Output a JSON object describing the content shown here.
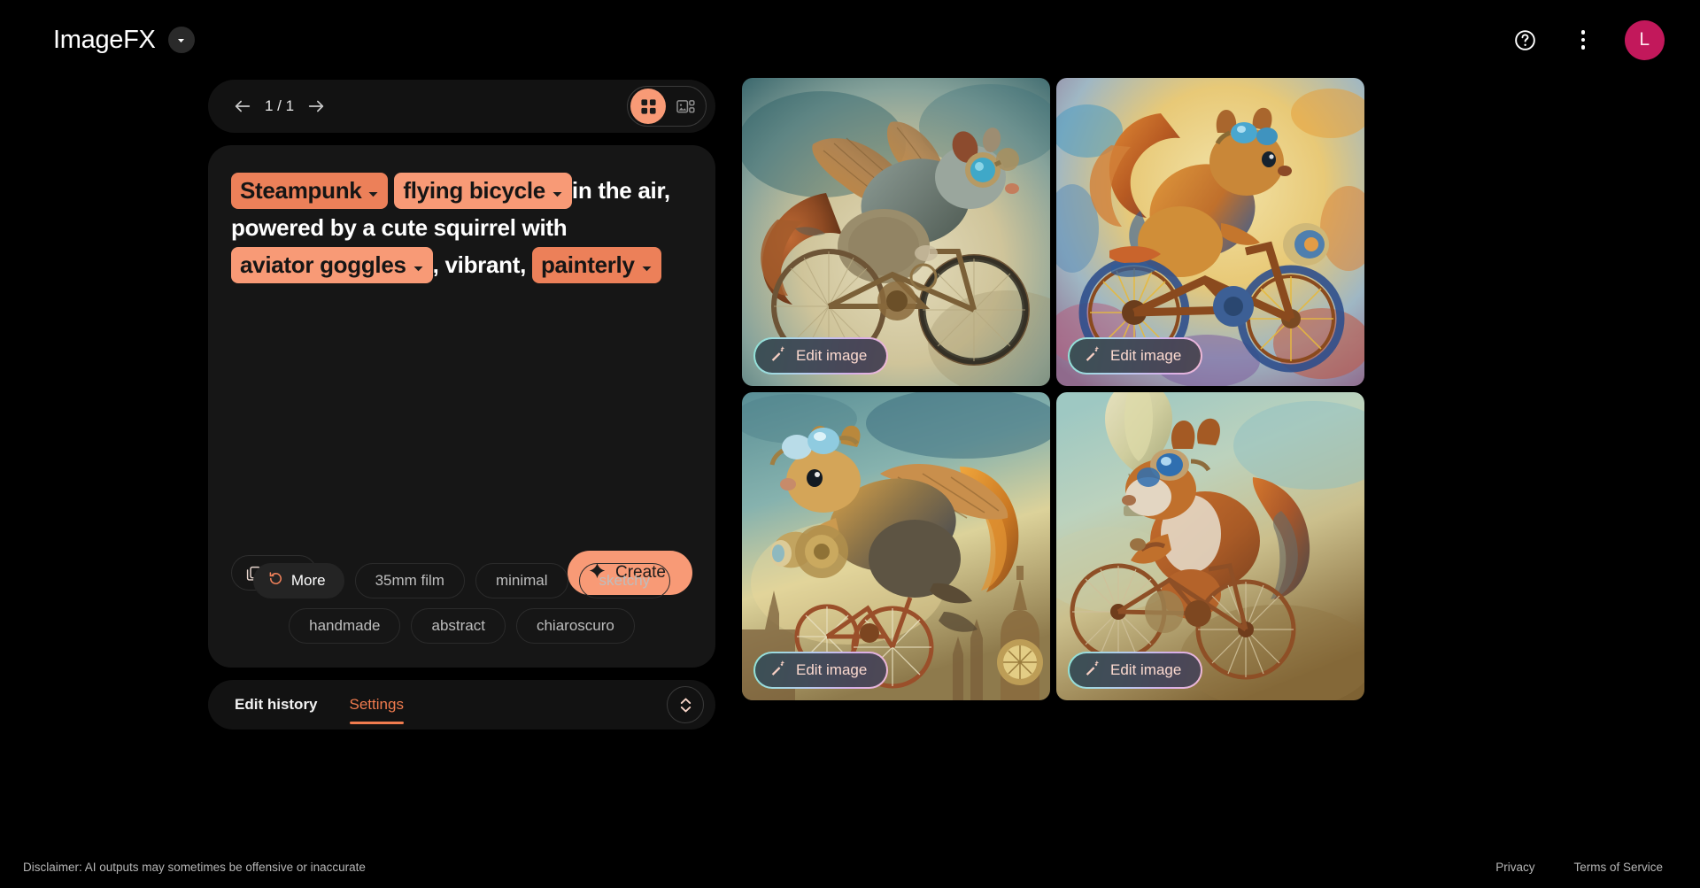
{
  "header": {
    "brand_title": "ImageFX",
    "brand_chevron_icon": "chevron-down-icon",
    "help_icon": "help-circle-icon",
    "overflow_icon": "more-vertical-icon",
    "avatar_initial": "L",
    "avatar_color": "#c2185b"
  },
  "navbar": {
    "prev_icon": "arrow-left-icon",
    "next_icon": "arrow-right-icon",
    "counter": "1 / 1",
    "grid_view_icon": "grid-view-icon",
    "detail_view_icon": "detail-view-icon",
    "active_view": "grid"
  },
  "prompt": {
    "segments": [
      {
        "type": "chip",
        "text": "Steampunk",
        "shade": "a"
      },
      {
        "type": "chip",
        "text": "flying bicycle",
        "shade": "b"
      },
      {
        "type": "text",
        "text": "in the air, powered by a cute squirrel with"
      },
      {
        "type": "chip",
        "text": "aviator goggles",
        "shade": "b"
      },
      {
        "type": "text",
        "text": ", vibrant,"
      },
      {
        "type": "chip",
        "text": "painterly",
        "shade": "a"
      }
    ],
    "full_text": "Steampunk flying bicycle in the air, powered by a cute squirrel with aviator goggles, vibrant, painterly",
    "copy_icon": "copy-icon",
    "reset_icon": "refresh-icon",
    "create_label": "Create",
    "create_icon": "sparkle-icon",
    "accent_color": "#f89a76"
  },
  "suggestions": {
    "more_label": "More",
    "more_icon": "refresh-icon",
    "row1": [
      "35mm film",
      "minimal",
      "sketchy"
    ],
    "row2": [
      "handmade",
      "abstract",
      "chiaroscuro"
    ]
  },
  "bottom_tabs": {
    "items": [
      {
        "label": "Edit history",
        "active": false
      },
      {
        "label": "Settings",
        "active": true
      }
    ],
    "expander_icon": "unfold-more-icon"
  },
  "gallery": {
    "edit_label": "Edit image",
    "edit_icon": "magic-wand-icon",
    "tiles": [
      {
        "id": "tile-1",
        "alt": "Winged steampunk squirrel riding bicycle on teal and cream background"
      },
      {
        "id": "tile-2",
        "alt": "Vibrant orange and blue painterly squirrel on bicycle"
      },
      {
        "id": "tile-3",
        "alt": "Golden squirrel with bat wing flying over steampunk city"
      },
      {
        "id": "tile-4",
        "alt": "Red squirrel with goggles on bicycle with hot air balloon"
      }
    ]
  },
  "footer": {
    "disclaimer": "Disclaimer: AI outputs may sometimes be offensive or inaccurate",
    "privacy": "Privacy",
    "terms": "Terms of Service"
  }
}
